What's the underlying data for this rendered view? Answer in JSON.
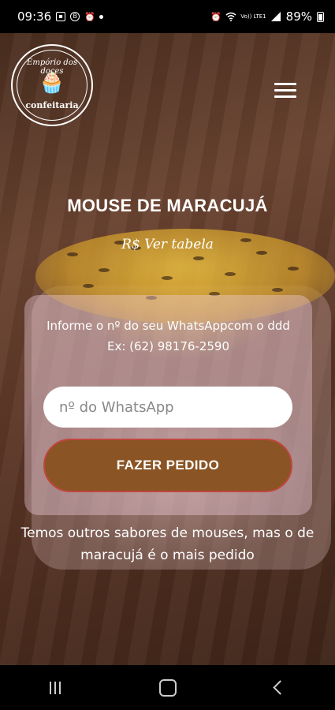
{
  "status_bar": {
    "time": "09:36",
    "network": "Vo)) LTE1",
    "battery": "89%"
  },
  "logo": {
    "top_text": "Empório dos doces",
    "bottom_text": "confeitaria"
  },
  "product": {
    "title": "MOUSE DE MARACUJÁ",
    "price": "R$ Ver tabela"
  },
  "form": {
    "instruction": "Informe o nº do seu WhatsAppcom o ddd Ex: (62) 98176-2590",
    "whatsapp_placeholder": "nº do WhatsApp",
    "order_button": "FAZER PEDIDO"
  },
  "footer_text": "Temos outros sabores de mouses, mas o de maracujá é o mais pedido",
  "colors": {
    "order_button_bg": "#8a5424",
    "order_button_border": "#c0463f",
    "card_bg": "rgba(245,210,230,0.38)"
  },
  "icons": [
    "image-icon",
    "b-icon",
    "alarm-icon",
    "alarm-icon",
    "wifi-icon",
    "signal-icon",
    "battery-icon",
    "hamburger-menu-icon",
    "recent-apps-icon",
    "home-icon",
    "back-icon"
  ]
}
